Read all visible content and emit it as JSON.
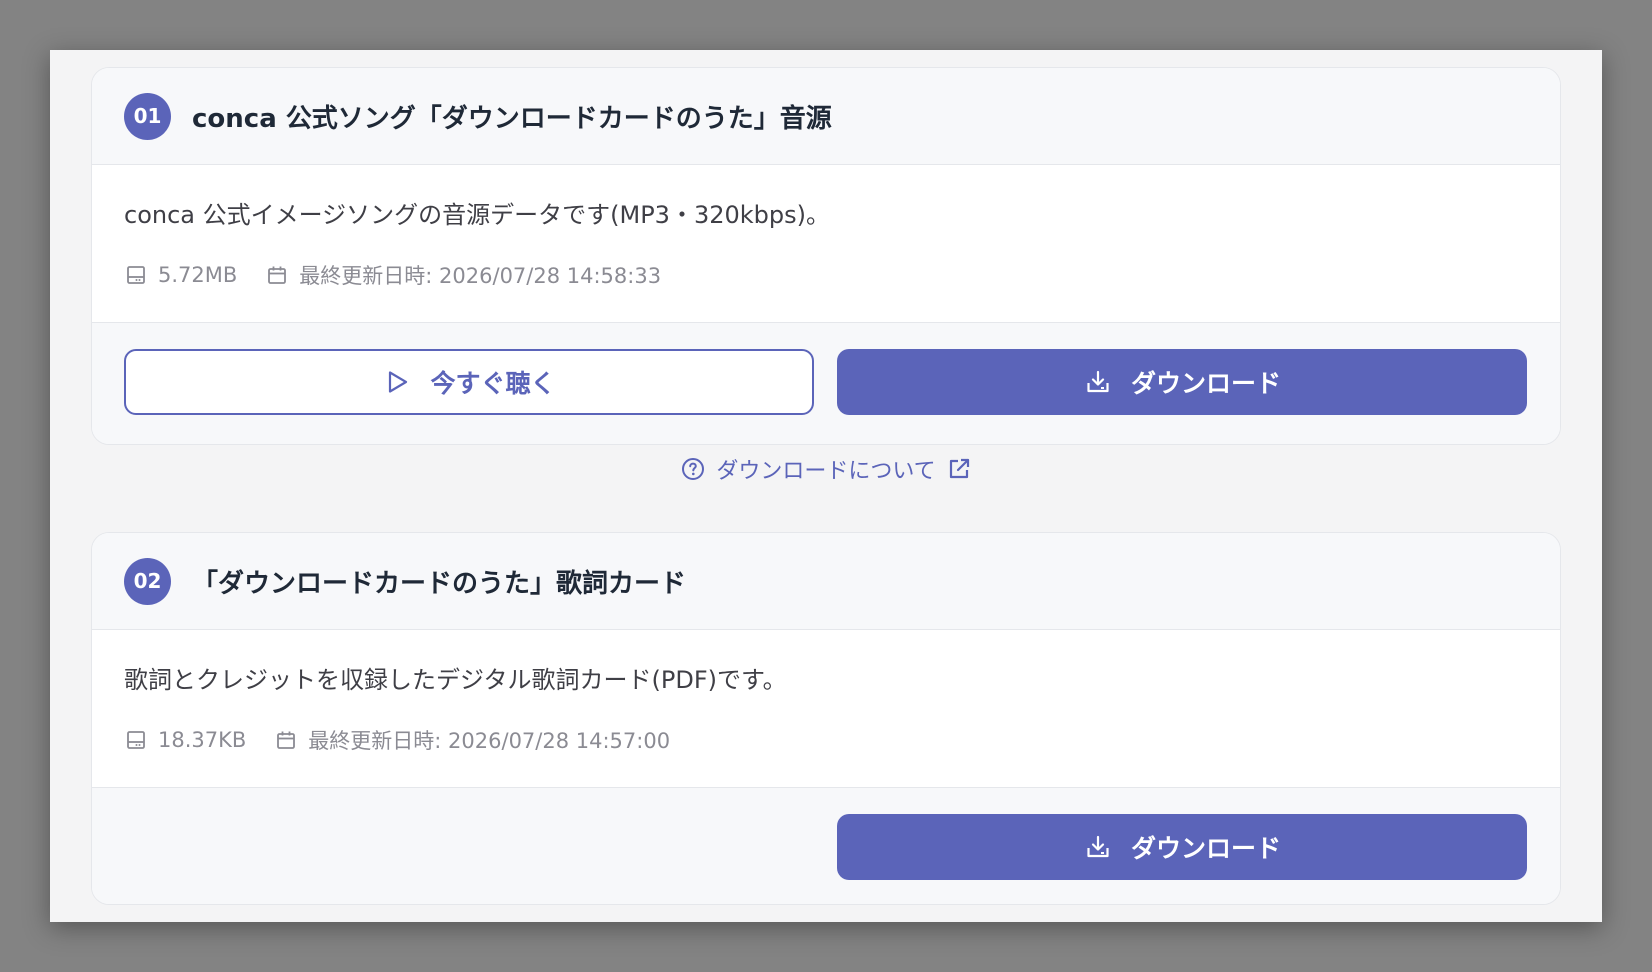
{
  "items": [
    {
      "number": "01",
      "title": "conca 公式ソング「ダウンロードカードのうた」音源",
      "description": "conca 公式イメージソングの音源データです(MP3・320kbps)。",
      "size": "5.72MB",
      "updated": "最終更新日時: 2026/07/28 14:58:33",
      "listen_label": "今すぐ聴く",
      "download_label": "ダウンロード"
    },
    {
      "number": "02",
      "title": "「ダウンロードカードのうた」歌詞カード",
      "description": "歌詞とクレジットを収録したデジタル歌詞カード(PDF)です。",
      "size": "18.37KB",
      "updated": "最終更新日時: 2026/07/28 14:57:00",
      "download_label": "ダウンロード"
    }
  ],
  "about_link": {
    "label": "ダウンロードについて"
  },
  "icons": {
    "size": "hard-drive-icon",
    "date": "calendar-icon",
    "play": "play-icon",
    "download": "download-icon",
    "help": "question-circle-icon",
    "external": "external-link-icon"
  },
  "colors": {
    "accent": "#5b64b9",
    "background": "#f4f4f5"
  }
}
